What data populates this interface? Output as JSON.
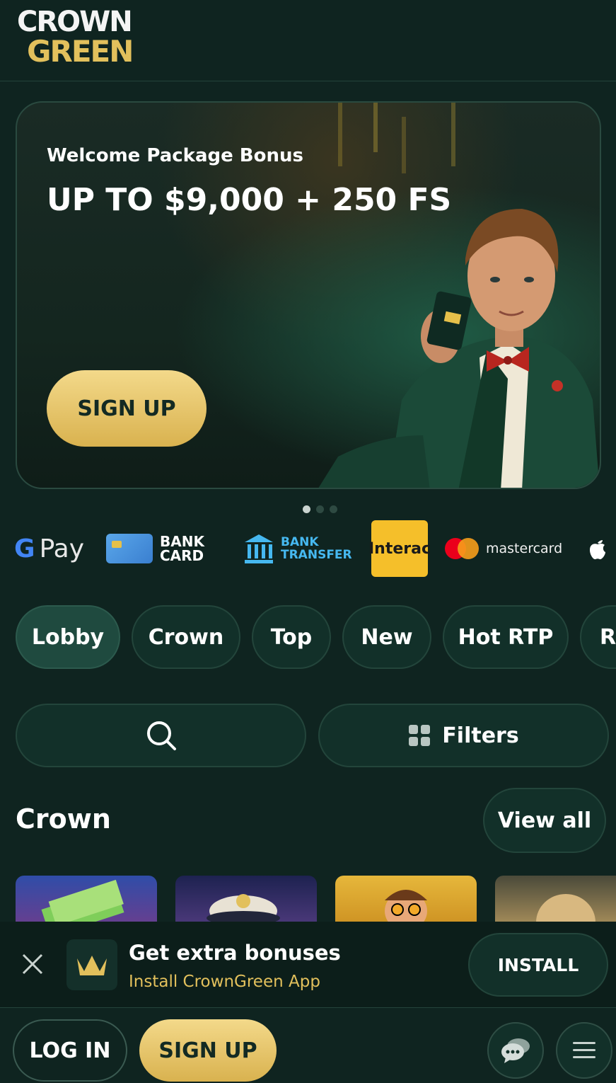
{
  "logo": {
    "line1": "CROWN",
    "line2": "GREEN"
  },
  "hero": {
    "subtitle": "Welcome Package Bonus",
    "title": "UP TO $9,000 + 250 FS",
    "cta": "SIGN UP",
    "card_text": "Interac"
  },
  "carousel": {
    "count": 3,
    "active_index": 0
  },
  "payments": {
    "gpay": {
      "g": "G",
      "pay": "Pay"
    },
    "bank_card": {
      "line1": "BANK",
      "line2": "CARD"
    },
    "bank_transfer": {
      "line1": "BANK",
      "line2": "TRANSFER"
    },
    "interac": "Interac",
    "mastercard": "mastercard"
  },
  "tabs": [
    {
      "label": "Lobby",
      "active": true
    },
    {
      "label": "Crown",
      "active": false
    },
    {
      "label": "Top",
      "active": false
    },
    {
      "label": "New",
      "active": false
    },
    {
      "label": "Hot RTP",
      "active": false
    },
    {
      "label": "R",
      "active": false
    }
  ],
  "search": {
    "icon": "search-icon"
  },
  "filters": {
    "label": "Filters",
    "icon": "grid-icon"
  },
  "section": {
    "title": "Crown",
    "view_all": "View all"
  },
  "app_banner": {
    "title": "Get extra bonuses",
    "subtitle": "Install CrownGreen App",
    "install": "INSTALL"
  },
  "footer": {
    "login": "LOG IN",
    "signup": "SIGN UP"
  },
  "colors": {
    "background": "#0f2420",
    "gold": "#e2c05c",
    "pill": "#123029",
    "pill_border": "#23453b"
  }
}
